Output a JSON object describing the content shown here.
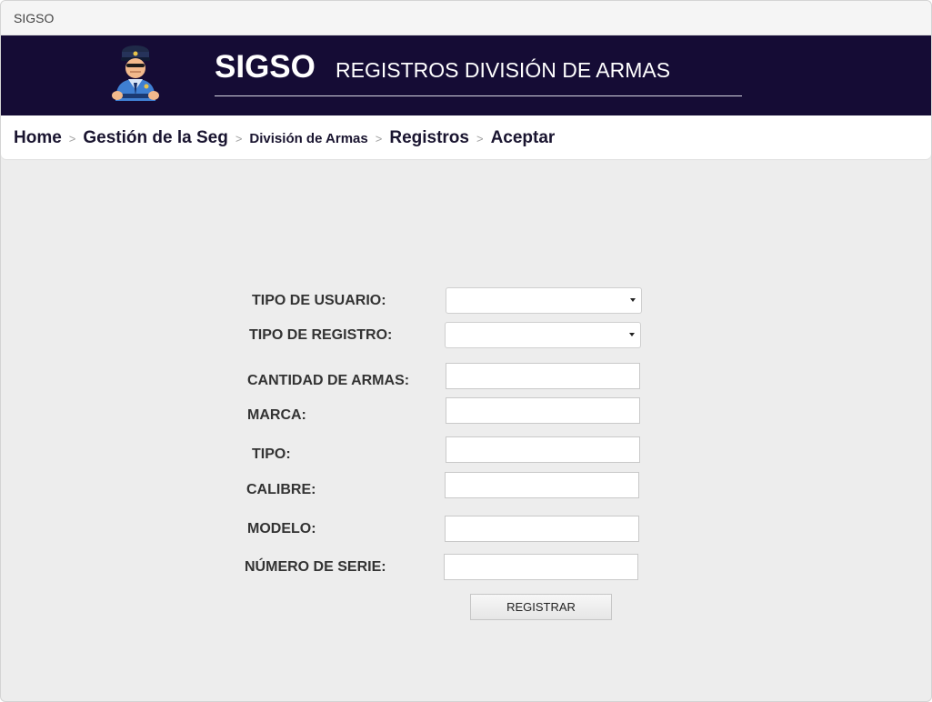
{
  "window": {
    "title": "SIGSO"
  },
  "header": {
    "brand": "SIGSO",
    "subtitle": "REGISTROS DIVISIÓN DE ARMAS",
    "logo_icon": "police-officer-icon",
    "bg_color": "#150c35"
  },
  "breadcrumb": {
    "separator": ">",
    "items": [
      {
        "label": "Home"
      },
      {
        "label": "Gestión de la Seg"
      },
      {
        "label": "División de Armas"
      },
      {
        "label": "Registros"
      },
      {
        "label": "Aceptar"
      }
    ]
  },
  "form": {
    "tipo_usuario": {
      "label": "TIPO DE  USUARIO:",
      "value": ""
    },
    "tipo_registro": {
      "label": "TIPO DE REGISTRO:",
      "value": ""
    },
    "cantidad_armas": {
      "label": "CANTIDAD DE ARMAS:",
      "value": ""
    },
    "marca": {
      "label": "MARCA:",
      "value": ""
    },
    "tipo": {
      "label": "TIPO:",
      "value": ""
    },
    "calibre": {
      "label": "CALIBRE:",
      "value": ""
    },
    "modelo": {
      "label": "MODELO:",
      "value": ""
    },
    "numero_serie": {
      "label": "NÚMERO DE SERIE:",
      "value": ""
    },
    "submit_label": "REGISTRAR"
  }
}
